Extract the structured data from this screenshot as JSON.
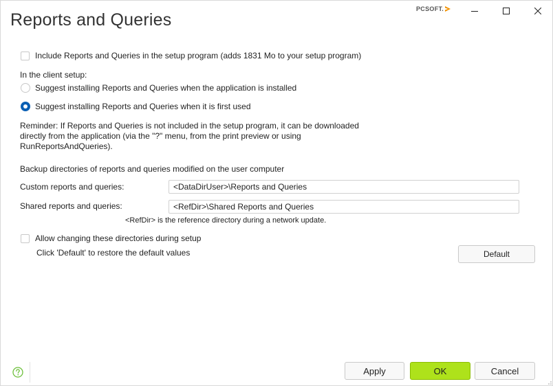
{
  "window": {
    "title": "Reports and Queries",
    "brand": "PCSOFT.",
    "controls": {
      "minimize": "minimize-icon",
      "maximize": "maximize-icon",
      "close": "close-icon"
    }
  },
  "options": {
    "include_label": "Include Reports and Queries in the setup program (adds 1831 Mo to your setup program)",
    "include_checked": false,
    "client_setup_label": "In the client setup:",
    "radio_install_label": "Suggest installing Reports and Queries when the application is installed",
    "radio_first_use_label": "Suggest installing Reports and Queries when it is first used",
    "selected_radio": "first_use"
  },
  "reminder": {
    "line1": "Reminder: If Reports and Queries is not included in the setup program, it can be downloaded",
    "line2": "directly from the application (via the \"?\" menu, from the print preview or using",
    "line3": "RunReportsAndQueries)."
  },
  "backup": {
    "heading": "Backup directories of reports and queries modified on the user computer",
    "custom_label": "Custom reports and queries:",
    "custom_value": "<DataDirUser>\\Reports and Queries",
    "shared_label": "Shared reports and queries:",
    "shared_value": "<RefDir>\\Shared Reports and Queries",
    "note": "<RefDir> is the reference directory during a network update.",
    "allow_change_label": "Allow changing these directories during setup",
    "allow_change_checked": false,
    "restore_hint": "Click 'Default' to restore the default values",
    "default_button": "Default"
  },
  "footer": {
    "help_icon": "help-icon",
    "apply": "Apply",
    "ok": "OK",
    "cancel": "Cancel"
  },
  "colors": {
    "accent_radio": "#0a5fb4",
    "ok_button": "#aee21b",
    "help_icon": "#6cbf3a",
    "brand_arrow": "#f39200"
  }
}
